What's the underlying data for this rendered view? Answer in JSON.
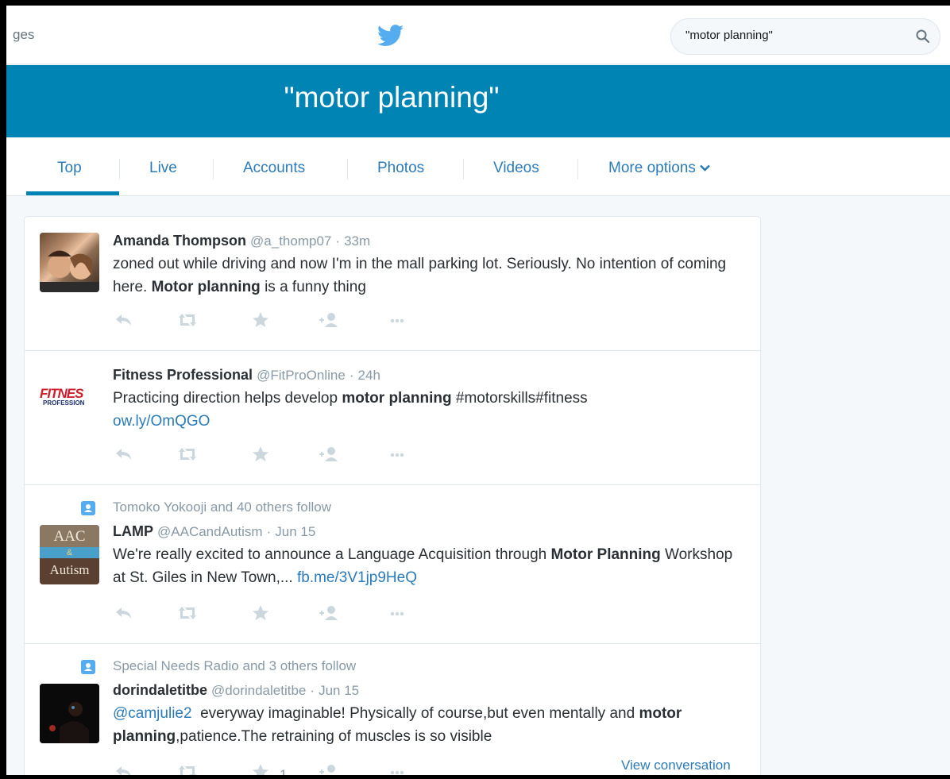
{
  "topbar": {
    "nav_partial_label": "ges",
    "search_value": "\"motor planning\""
  },
  "header": {
    "title": "\"motor planning\""
  },
  "tabs": [
    {
      "label": "Top",
      "active": true
    },
    {
      "label": "Live"
    },
    {
      "label": "Accounts"
    },
    {
      "label": "Photos"
    },
    {
      "label": "Videos"
    },
    {
      "label": "More options"
    }
  ],
  "tweets": [
    {
      "name": "Amanda Thompson",
      "handle": "@a_thomp07",
      "time": "33m",
      "text_parts": [
        "zoned out while driving and now I'm in the mall parking lot. Seriously. No intention of coming here. ",
        "Motor planning",
        " is a funny thing"
      ]
    },
    {
      "name": "Fitness Professional",
      "handle": "@FitProOnline",
      "time": "24h",
      "avatar_text_top": "FITNES",
      "avatar_text_bottom": "PROFESSION",
      "text_parts": [
        "Practicing direction helps develop ",
        "motor planning",
        " #motorskills#fitness"
      ],
      "link": "ow.ly/OmQGO"
    },
    {
      "context": "Tomoko Yokooji and 40 others follow",
      "name": "LAMP",
      "handle": "@AACandAutism",
      "time": "Jun 15",
      "avatar_text_top": "AAC",
      "avatar_text_mid": "&",
      "avatar_text_bottom": "Autism",
      "text_parts": [
        "We're really excited to announce a Language Acquisition through ",
        "Motor Planning",
        " Workshop at St. Giles in New Town,... "
      ],
      "link": "fb.me/3V1jp9HeQ"
    },
    {
      "context": "Special Needs Radio and 3 others follow",
      "name": "dorindaletitbe",
      "handle": "@dorindaletitbe",
      "time": "Jun 15",
      "mention": "@camjulie2",
      "text_parts": [
        "  everyway imaginable! Physically of course,but even mentally and ",
        "motor planning",
        ",patience.The retraining of muscles is so visible"
      ],
      "star_count": "1",
      "view_conversation": "View conversation"
    }
  ],
  "separator": "·",
  "colors": {
    "brand": "#0084b4",
    "link": "#2b7bb9",
    "muted": "#8899a6"
  },
  "icons": [
    "twitter-bird-icon",
    "search-icon",
    "chevron-down-icon",
    "reply-icon",
    "retweet-icon",
    "favorite-icon",
    "follow-icon",
    "more-icon",
    "follow-context-icon"
  ]
}
